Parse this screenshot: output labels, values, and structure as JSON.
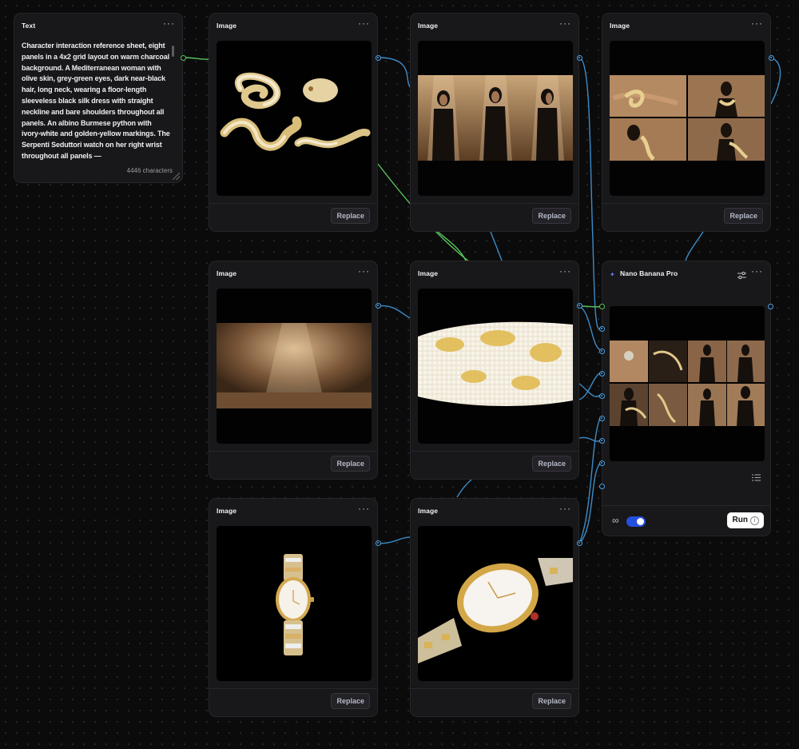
{
  "text_node": {
    "title": "Text",
    "content": "Character interaction reference sheet, eight panels in a 4x2 grid layout on warm charcoal background. A Mediterranean woman with olive skin, grey-green eyes, dark near-black hair, long neck, wearing a floor-length sleeveless black silk dress with straight neckline and bare shoulders throughout all panels. An albino Burmese python with ivory-white and golden-yellow markings. The Serpenti Seduttori watch on her right wrist throughout all panels —",
    "char_count": "4446 characters"
  },
  "image_nodes": [
    {
      "title": "Image",
      "button": "Replace",
      "content": "albino python poses"
    },
    {
      "title": "Image",
      "button": "Replace",
      "content": "three women in black dresses"
    },
    {
      "title": "Image",
      "button": "Replace",
      "content": "woman with python grid"
    },
    {
      "title": "Image",
      "button": "Replace",
      "content": "spotlight wall"
    },
    {
      "title": "Image",
      "button": "Replace",
      "content": "python scales close-up"
    },
    {
      "title": "Image",
      "button": "Replace",
      "content": "watch front"
    },
    {
      "title": "Image",
      "button": "Replace",
      "content": "watch angle"
    }
  ],
  "generator": {
    "title": "Nano Banana Pro",
    "run_label": "Run",
    "info_glyph": "i",
    "toggle_on": true,
    "accent": "#2450e0"
  },
  "menu_glyph": "···",
  "colors": {
    "wire_blue": "#4ea3e6",
    "wire_green": "#58c25a",
    "node_bg": "#18181b"
  }
}
